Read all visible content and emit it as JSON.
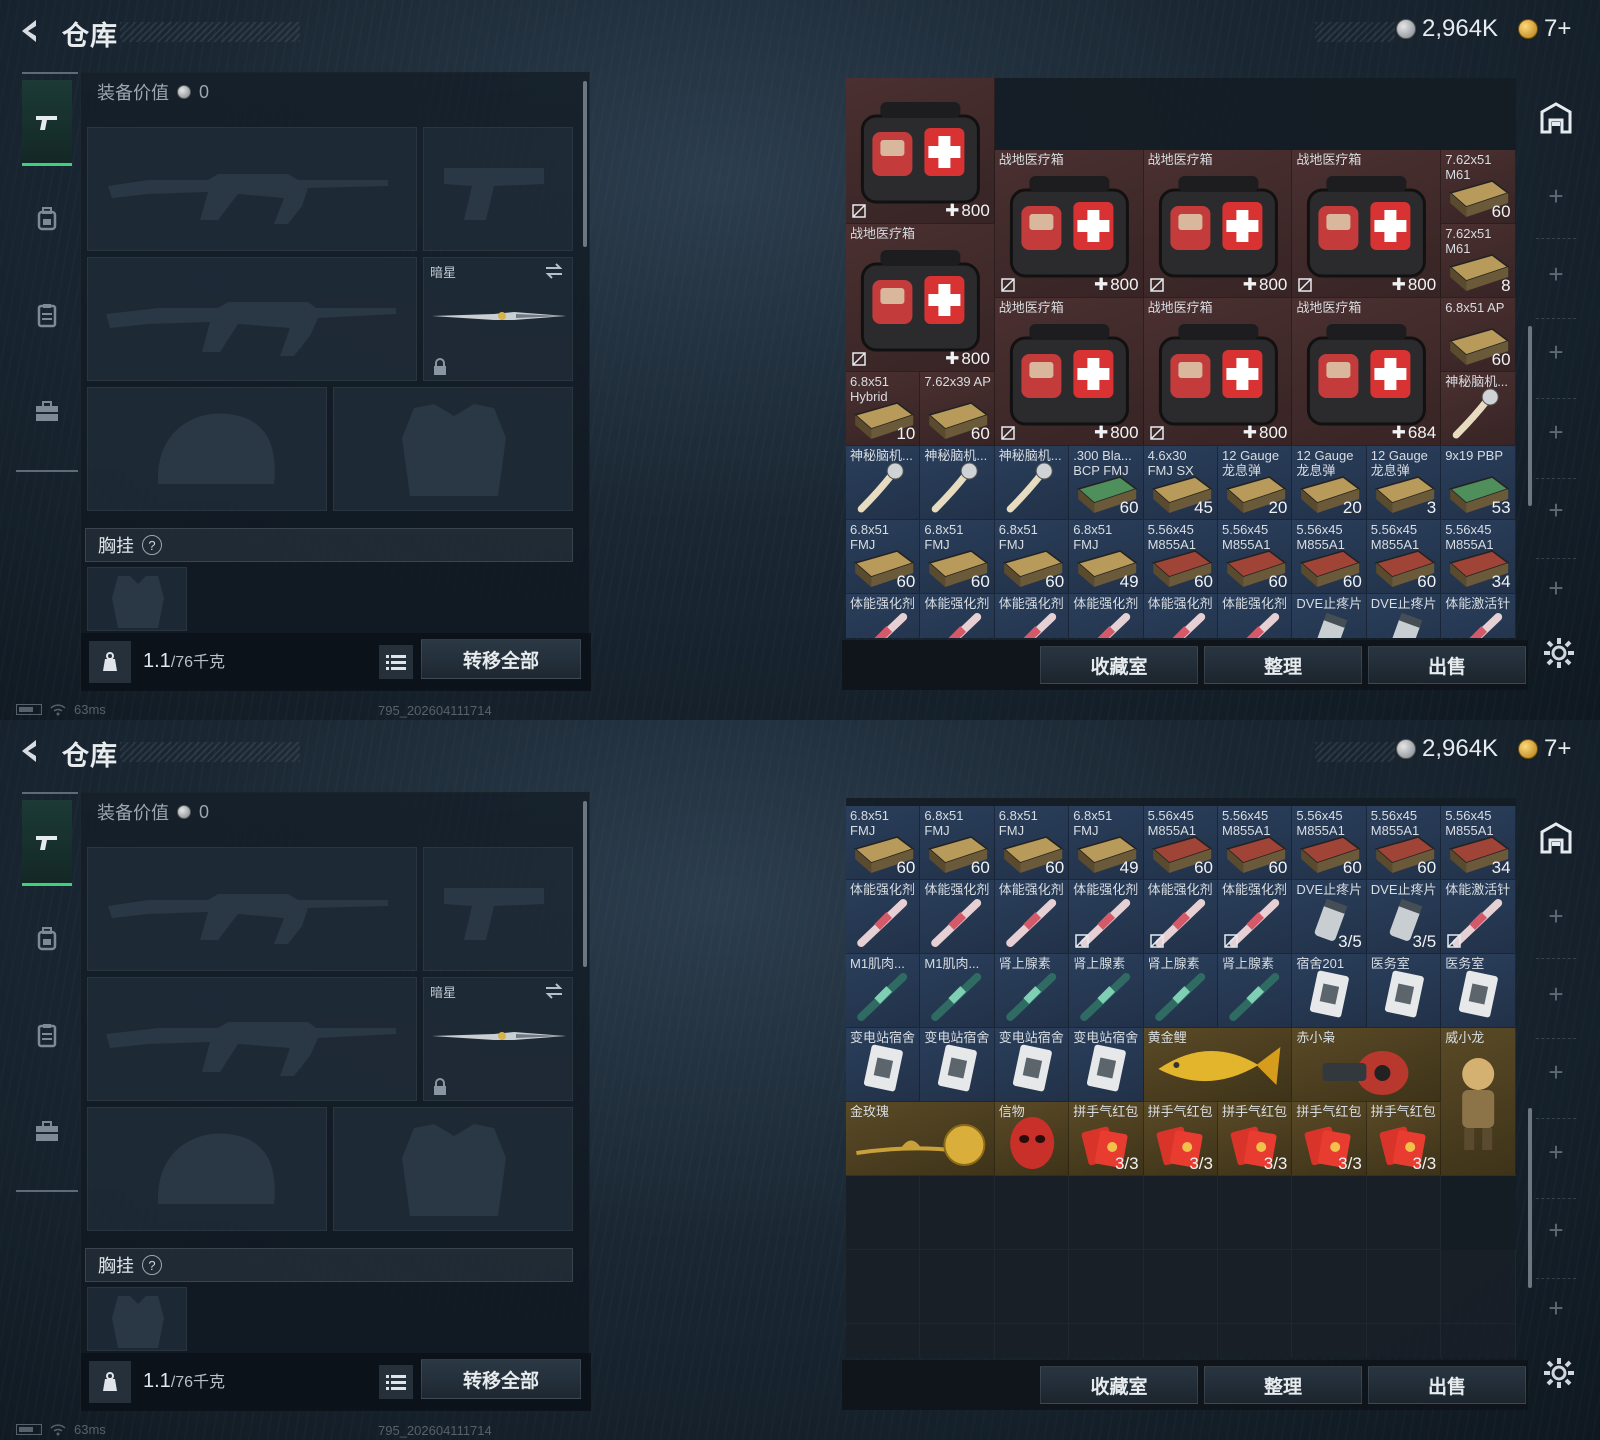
{
  "screens": [
    {
      "title": "仓库",
      "currency_silver": "2,964K",
      "currency_gold": "7+",
      "equip_value_label": "装备价值",
      "equip_value": "0",
      "melee_slot_name": "暗星",
      "chest_rig_label": "胸挂",
      "chest_rig_help": "?",
      "weight_value": "1.1",
      "weight_cap": "/76千克",
      "transfer_all": "转移全部",
      "btn_collection": "收藏室",
      "btn_sort": "整理",
      "btn_sell": "出售",
      "ping": "63ms",
      "build_id": "795_202604111714"
    },
    {
      "title": "仓库",
      "currency_silver": "2,964K",
      "currency_gold": "7+",
      "equip_value_label": "装备价值",
      "equip_value": "0",
      "melee_slot_name": "暗星",
      "chest_rig_label": "胸挂",
      "chest_rig_help": "?",
      "weight_value": "1.1",
      "weight_cap": "/76千克",
      "transfer_all": "转移全部",
      "btn_collection": "收藏室",
      "btn_sort": "整理",
      "btn_sell": "出售",
      "ping": "63ms",
      "build_id": "795_202604111714"
    }
  ],
  "stash_top": {
    "items": [
      {
        "name": "",
        "kind": "medkit",
        "col": 0,
        "row": -1,
        "w": 2,
        "h": 2,
        "rarity": "red",
        "heal": "800",
        "nobind": true
      },
      {
        "name": "战地医疗箱",
        "kind": "medkit",
        "col": 2,
        "row": 0,
        "w": 2,
        "h": 2,
        "rarity": "red",
        "heal": "800",
        "nobind": true
      },
      {
        "name": "战地医疗箱",
        "kind": "medkit",
        "col": 4,
        "row": 0,
        "w": 2,
        "h": 2,
        "rarity": "red",
        "heal": "800",
        "nobind": true
      },
      {
        "name": "战地医疗箱",
        "kind": "medkit",
        "col": 6,
        "row": 0,
        "w": 2,
        "h": 2,
        "rarity": "red",
        "heal": "800",
        "nobind": true
      },
      {
        "name": "7.62x51 M61",
        "kind": "ammo",
        "col": 8,
        "row": 0,
        "w": 1,
        "h": 1,
        "rarity": "red",
        "count": "60"
      },
      {
        "name": "战地医疗箱",
        "kind": "medkit",
        "col": 0,
        "row": 1,
        "w": 2,
        "h": 2,
        "rarity": "red",
        "heal": "800",
        "nobind": true
      },
      {
        "name": "7.62x51 M61",
        "kind": "ammo",
        "col": 8,
        "row": 1,
        "w": 1,
        "h": 1,
        "rarity": "red",
        "count": "8"
      },
      {
        "name": "战地医疗箱",
        "kind": "medkit",
        "col": 2,
        "row": 2,
        "w": 2,
        "h": 2,
        "rarity": "red",
        "heal": "800",
        "nobind": true
      },
      {
        "name": "战地医疗箱",
        "kind": "medkit",
        "col": 4,
        "row": 2,
        "w": 2,
        "h": 2,
        "rarity": "red",
        "heal": "800",
        "nobind": true
      },
      {
        "name": "战地医疗箱",
        "kind": "medkit",
        "col": 6,
        "row": 2,
        "w": 2,
        "h": 2,
        "rarity": "red",
        "heal": "684",
        "nobind": false
      },
      {
        "name": "6.8x51 AP",
        "kind": "ammo",
        "col": 8,
        "row": 2,
        "w": 1,
        "h": 1,
        "rarity": "red",
        "count": "60"
      },
      {
        "name": "6.8x51 Hybrid",
        "kind": "ammo",
        "col": 0,
        "row": 3,
        "w": 1,
        "h": 1,
        "rarity": "red",
        "count": "10"
      },
      {
        "name": "7.62x39 AP",
        "kind": "ammo",
        "col": 1,
        "row": 3,
        "w": 1,
        "h": 1,
        "rarity": "red",
        "count": "60"
      },
      {
        "name": "神秘脑机...",
        "kind": "brain",
        "col": 8,
        "row": 3,
        "w": 1,
        "h": 1,
        "rarity": "red"
      },
      {
        "name": "神秘脑机...",
        "kind": "brain",
        "col": 0,
        "row": 4,
        "w": 1,
        "h": 1,
        "rarity": "blue"
      },
      {
        "name": "神秘脑机...",
        "kind": "brain",
        "col": 1,
        "row": 4,
        "w": 1,
        "h": 1,
        "rarity": "blue"
      },
      {
        "name": "神秘脑机...",
        "kind": "brain",
        "col": 2,
        "row": 4,
        "w": 1,
        "h": 1,
        "rarity": "blue"
      },
      {
        "name": ".300 Bla... BCP FMJ",
        "kind": "ammo-green",
        "col": 3,
        "row": 4,
        "w": 1,
        "h": 1,
        "rarity": "blue",
        "count": "60"
      },
      {
        "name": "4.6x30 FMJ SX",
        "kind": "ammo",
        "col": 4,
        "row": 4,
        "w": 1,
        "h": 1,
        "rarity": "blue",
        "count": "45"
      },
      {
        "name": "12 Gauge 龙息弹",
        "kind": "ammo",
        "col": 5,
        "row": 4,
        "w": 1,
        "h": 1,
        "rarity": "blue",
        "count": "20"
      },
      {
        "name": "12 Gauge 龙息弹",
        "kind": "ammo",
        "col": 6,
        "row": 4,
        "w": 1,
        "h": 1,
        "rarity": "blue",
        "count": "20"
      },
      {
        "name": "12 Gauge 龙息弹",
        "kind": "ammo",
        "col": 7,
        "row": 4,
        "w": 1,
        "h": 1,
        "rarity": "blue",
        "count": "3"
      },
      {
        "name": "9x19 PBP",
        "kind": "ammo-green",
        "col": 8,
        "row": 4,
        "w": 1,
        "h": 1,
        "rarity": "blue",
        "count": "53"
      },
      {
        "name": "6.8x51 FMJ",
        "kind": "ammo",
        "col": 0,
        "row": 5,
        "w": 1,
        "h": 1,
        "rarity": "blue",
        "count": "60"
      },
      {
        "name": "6.8x51 FMJ",
        "kind": "ammo",
        "col": 1,
        "row": 5,
        "w": 1,
        "h": 1,
        "rarity": "blue",
        "count": "60"
      },
      {
        "name": "6.8x51 FMJ",
        "kind": "ammo",
        "col": 2,
        "row": 5,
        "w": 1,
        "h": 1,
        "rarity": "blue",
        "count": "60"
      },
      {
        "name": "6.8x51 FMJ",
        "kind": "ammo",
        "col": 3,
        "row": 5,
        "w": 1,
        "h": 1,
        "rarity": "blue",
        "count": "49"
      },
      {
        "name": "5.56x45 M855A1",
        "kind": "ammo-red",
        "col": 4,
        "row": 5,
        "w": 1,
        "h": 1,
        "rarity": "blue",
        "count": "60"
      },
      {
        "name": "5.56x45 M855A1",
        "kind": "ammo-red",
        "col": 5,
        "row": 5,
        "w": 1,
        "h": 1,
        "rarity": "blue",
        "count": "60"
      },
      {
        "name": "5.56x45 M855A1",
        "kind": "ammo-red",
        "col": 6,
        "row": 5,
        "w": 1,
        "h": 1,
        "rarity": "blue",
        "count": "60"
      },
      {
        "name": "5.56x45 M855A1",
        "kind": "ammo-red",
        "col": 7,
        "row": 5,
        "w": 1,
        "h": 1,
        "rarity": "blue",
        "count": "60"
      },
      {
        "name": "5.56x45 M855A1",
        "kind": "ammo-red",
        "col": 8,
        "row": 5,
        "w": 1,
        "h": 1,
        "rarity": "blue",
        "count": "34"
      },
      {
        "name": "体能强化剂",
        "kind": "syringe",
        "col": 0,
        "row": 6,
        "w": 1,
        "h": 1,
        "rarity": "blue"
      },
      {
        "name": "体能强化剂",
        "kind": "syringe",
        "col": 1,
        "row": 6,
        "w": 1,
        "h": 1,
        "rarity": "blue"
      },
      {
        "name": "体能强化剂",
        "kind": "syringe",
        "col": 2,
        "row": 6,
        "w": 1,
        "h": 1,
        "rarity": "blue"
      },
      {
        "name": "体能强化剂",
        "kind": "syringe",
        "col": 3,
        "row": 6,
        "w": 1,
        "h": 1,
        "rarity": "blue",
        "nobind": true
      },
      {
        "name": "体能强化剂",
        "kind": "syringe",
        "col": 4,
        "row": 6,
        "w": 1,
        "h": 1,
        "rarity": "blue",
        "nobind": true
      },
      {
        "name": "体能强化剂",
        "kind": "syringe",
        "col": 5,
        "row": 6,
        "w": 1,
        "h": 1,
        "rarity": "blue",
        "nobind": true
      },
      {
        "name": "DVE止疼片",
        "kind": "pills",
        "col": 6,
        "row": 6,
        "w": 1,
        "h": 1,
        "rarity": "blue",
        "uses": "3/5"
      },
      {
        "name": "DVE止疼片",
        "kind": "pills",
        "col": 7,
        "row": 6,
        "w": 1,
        "h": 1,
        "rarity": "blue",
        "uses": "3/5"
      },
      {
        "name": "体能激活针",
        "kind": "syringe",
        "col": 8,
        "row": 6,
        "w": 1,
        "h": 1,
        "rarity": "blue",
        "nobind": true
      },
      {
        "name": "M1肌肉...",
        "kind": "syringe-green",
        "col": 0,
        "row": 7,
        "w": 1,
        "h": 1,
        "rarity": "blue"
      },
      {
        "name": "M1肌肉...",
        "kind": "syringe-green",
        "col": 1,
        "row": 7,
        "w": 1,
        "h": 1,
        "rarity": "blue"
      },
      {
        "name": "肾上腺素",
        "kind": "syringe-green",
        "col": 2,
        "row": 7,
        "w": 1,
        "h": 1,
        "rarity": "blue"
      },
      {
        "name": "肾上腺素",
        "kind": "syringe-green",
        "col": 3,
        "row": 7,
        "w": 1,
        "h": 1,
        "rarity": "blue"
      },
      {
        "name": "肾上腺素",
        "kind": "syringe-green",
        "col": 4,
        "row": 7,
        "w": 1,
        "h": 1,
        "rarity": "blue"
      },
      {
        "name": "肾上腺素",
        "kind": "syringe-green",
        "col": 5,
        "row": 7,
        "w": 1,
        "h": 1,
        "rarity": "blue"
      },
      {
        "name": "宿舍201",
        "kind": "keycard",
        "col": 6,
        "row": 7,
        "w": 1,
        "h": 1,
        "rarity": "blue"
      },
      {
        "name": "医务室",
        "kind": "keycard",
        "col": 7,
        "row": 7,
        "w": 1,
        "h": 1,
        "rarity": "blue"
      },
      {
        "name": "医务室",
        "kind": "keycard",
        "col": 8,
        "row": 7,
        "w": 1,
        "h": 1,
        "rarity": "blue"
      }
    ]
  },
  "stash_bottom": {
    "items": [
      {
        "name": "6.8x51 FMJ",
        "kind": "ammo",
        "col": 0,
        "row": 0,
        "w": 1,
        "h": 1,
        "rarity": "blue",
        "count": "60"
      },
      {
        "name": "6.8x51 FMJ",
        "kind": "ammo",
        "col": 1,
        "row": 0,
        "w": 1,
        "h": 1,
        "rarity": "blue",
        "count": "60"
      },
      {
        "name": "6.8x51 FMJ",
        "kind": "ammo",
        "col": 2,
        "row": 0,
        "w": 1,
        "h": 1,
        "rarity": "blue",
        "count": "60"
      },
      {
        "name": "6.8x51 FMJ",
        "kind": "ammo",
        "col": 3,
        "row": 0,
        "w": 1,
        "h": 1,
        "rarity": "blue",
        "count": "49"
      },
      {
        "name": "5.56x45 M855A1",
        "kind": "ammo-red",
        "col": 4,
        "row": 0,
        "w": 1,
        "h": 1,
        "rarity": "blue",
        "count": "60"
      },
      {
        "name": "5.56x45 M855A1",
        "kind": "ammo-red",
        "col": 5,
        "row": 0,
        "w": 1,
        "h": 1,
        "rarity": "blue",
        "count": "60"
      },
      {
        "name": "5.56x45 M855A1",
        "kind": "ammo-red",
        "col": 6,
        "row": 0,
        "w": 1,
        "h": 1,
        "rarity": "blue",
        "count": "60"
      },
      {
        "name": "5.56x45 M855A1",
        "kind": "ammo-red",
        "col": 7,
        "row": 0,
        "w": 1,
        "h": 1,
        "rarity": "blue",
        "count": "60"
      },
      {
        "name": "5.56x45 M855A1",
        "kind": "ammo-red",
        "col": 8,
        "row": 0,
        "w": 1,
        "h": 1,
        "rarity": "blue",
        "count": "34"
      },
      {
        "name": "体能强化剂",
        "kind": "syringe",
        "col": 0,
        "row": 1,
        "w": 1,
        "h": 1,
        "rarity": "blue"
      },
      {
        "name": "体能强化剂",
        "kind": "syringe",
        "col": 1,
        "row": 1,
        "w": 1,
        "h": 1,
        "rarity": "blue"
      },
      {
        "name": "体能强化剂",
        "kind": "syringe",
        "col": 2,
        "row": 1,
        "w": 1,
        "h": 1,
        "rarity": "blue"
      },
      {
        "name": "体能强化剂",
        "kind": "syringe",
        "col": 3,
        "row": 1,
        "w": 1,
        "h": 1,
        "rarity": "blue",
        "nobind": true
      },
      {
        "name": "体能强化剂",
        "kind": "syringe",
        "col": 4,
        "row": 1,
        "w": 1,
        "h": 1,
        "rarity": "blue",
        "nobind": true
      },
      {
        "name": "体能强化剂",
        "kind": "syringe",
        "col": 5,
        "row": 1,
        "w": 1,
        "h": 1,
        "rarity": "blue",
        "nobind": true
      },
      {
        "name": "DVE止疼片",
        "kind": "pills",
        "col": 6,
        "row": 1,
        "w": 1,
        "h": 1,
        "rarity": "blue",
        "uses": "3/5"
      },
      {
        "name": "DVE止疼片",
        "kind": "pills",
        "col": 7,
        "row": 1,
        "w": 1,
        "h": 1,
        "rarity": "blue",
        "uses": "3/5"
      },
      {
        "name": "体能激活针",
        "kind": "syringe",
        "col": 8,
        "row": 1,
        "w": 1,
        "h": 1,
        "rarity": "blue",
        "nobind": true
      },
      {
        "name": "M1肌肉...",
        "kind": "syringe-green",
        "col": 0,
        "row": 2,
        "w": 1,
        "h": 1,
        "rarity": "blue"
      },
      {
        "name": "M1肌肉...",
        "kind": "syringe-green",
        "col": 1,
        "row": 2,
        "w": 1,
        "h": 1,
        "rarity": "blue"
      },
      {
        "name": "肾上腺素",
        "kind": "syringe-green",
        "col": 2,
        "row": 2,
        "w": 1,
        "h": 1,
        "rarity": "blue"
      },
      {
        "name": "肾上腺素",
        "kind": "syringe-green",
        "col": 3,
        "row": 2,
        "w": 1,
        "h": 1,
        "rarity": "blue"
      },
      {
        "name": "肾上腺素",
        "kind": "syringe-green",
        "col": 4,
        "row": 2,
        "w": 1,
        "h": 1,
        "rarity": "blue"
      },
      {
        "name": "肾上腺素",
        "kind": "syringe-green",
        "col": 5,
        "row": 2,
        "w": 1,
        "h": 1,
        "rarity": "blue"
      },
      {
        "name": "宿舍201",
        "kind": "keycard",
        "col": 6,
        "row": 2,
        "w": 1,
        "h": 1,
        "rarity": "blue"
      },
      {
        "name": "医务室",
        "kind": "keycard",
        "col": 7,
        "row": 2,
        "w": 1,
        "h": 1,
        "rarity": "blue"
      },
      {
        "name": "医务室",
        "kind": "keycard",
        "col": 8,
        "row": 2,
        "w": 1,
        "h": 1,
        "rarity": "blue"
      },
      {
        "name": "变电站宿舍",
        "kind": "keycard",
        "col": 0,
        "row": 3,
        "w": 1,
        "h": 1,
        "rarity": "blue"
      },
      {
        "name": "变电站宿舍",
        "kind": "keycard",
        "col": 1,
        "row": 3,
        "w": 1,
        "h": 1,
        "rarity": "blue"
      },
      {
        "name": "变电站宿舍",
        "kind": "keycard",
        "col": 2,
        "row": 3,
        "w": 1,
        "h": 1,
        "rarity": "blue"
      },
      {
        "name": "变电站宿舍",
        "kind": "keycard",
        "col": 3,
        "row": 3,
        "w": 1,
        "h": 1,
        "rarity": "blue"
      },
      {
        "name": "黄金鲤",
        "kind": "fish",
        "col": 4,
        "row": 3,
        "w": 2,
        "h": 1,
        "rarity": "gold"
      },
      {
        "name": "赤小枭",
        "kind": "figure-red",
        "col": 6,
        "row": 3,
        "w": 2,
        "h": 1,
        "rarity": "gold"
      },
      {
        "name": "威小龙",
        "kind": "figure",
        "col": 8,
        "row": 3,
        "w": 1,
        "h": 2,
        "rarity": "gold"
      },
      {
        "name": "金玫瑰",
        "kind": "rose",
        "col": 0,
        "row": 4,
        "w": 2,
        "h": 1,
        "rarity": "gold"
      },
      {
        "name": "信物",
        "kind": "mask",
        "col": 2,
        "row": 4,
        "w": 1,
        "h": 1,
        "rarity": "gold"
      },
      {
        "name": "拼手气红包",
        "kind": "envelope",
        "col": 3,
        "row": 4,
        "w": 1,
        "h": 1,
        "rarity": "gold",
        "uses": "3/3"
      },
      {
        "name": "拼手气红包",
        "kind": "envelope",
        "col": 4,
        "row": 4,
        "w": 1,
        "h": 1,
        "rarity": "gold",
        "uses": "3/3"
      },
      {
        "name": "拼手气红包",
        "kind": "envelope",
        "col": 5,
        "row": 4,
        "w": 1,
        "h": 1,
        "rarity": "gold",
        "uses": "3/3"
      },
      {
        "name": "拼手气红包",
        "kind": "envelope",
        "col": 6,
        "row": 4,
        "w": 1,
        "h": 1,
        "rarity": "gold",
        "uses": "3/3"
      },
      {
        "name": "拼手气红包",
        "kind": "envelope",
        "col": 7,
        "row": 4,
        "w": 1,
        "h": 1,
        "rarity": "gold",
        "uses": "3/3"
      }
    ],
    "empty_rows": 3
  },
  "colors": {
    "accent_green": "#3fd07e",
    "rarity_red": "#4b3030",
    "rarity_blue": "#2a3f5c",
    "rarity_gold": "#5a4a26"
  }
}
